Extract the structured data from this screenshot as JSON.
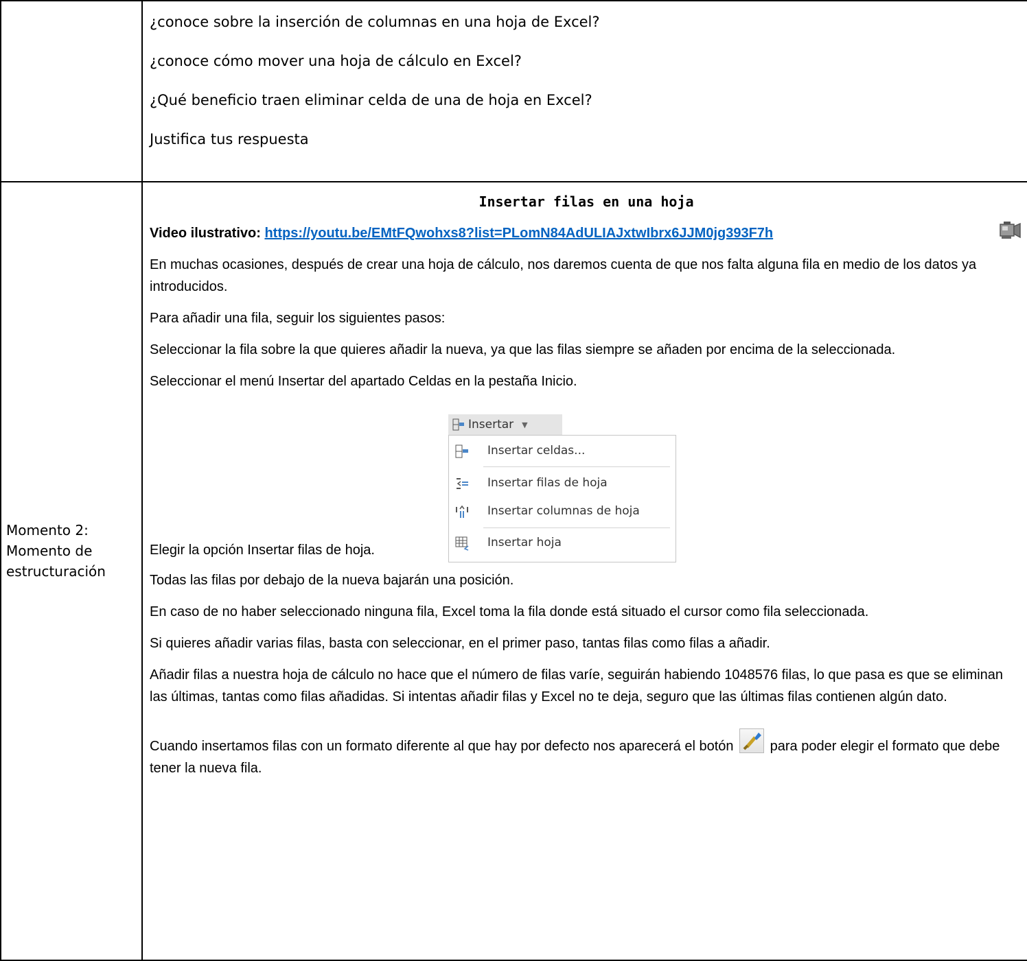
{
  "row1": {
    "questions": [
      "¿conoce sobre la inserción de columnas en una hoja de Excel?",
      "¿conoce cómo mover una hoja de cálculo en Excel?",
      "¿Qué beneficio traen eliminar celda de una de hoja en Excel?",
      "Justifica tus respuesta"
    ]
  },
  "row2": {
    "label_line1": "Momento 2:",
    "label_line2": "Momento de",
    "label_line3": "estructuración",
    "title": "Insertar filas en una hoja",
    "video_label": "Video ilustrativo: ",
    "video_url": "https://youtu.be/EMtFQwohxs8?list=PLomN84AdULIAJxtwIbrx6JJM0jg393F7h",
    "paragraphs": [
      "En muchas ocasiones, después de crear una hoja de cálculo, nos daremos cuenta de que nos falta alguna fila en medio de los datos ya introducidos.",
      "Para añadir una fila, seguir los siguientes pasos:",
      "Seleccionar la fila sobre la que quieres añadir la nueva, ya que las filas siempre se añaden por encima de la seleccionada.",
      "Seleccionar el menú Insertar del apartado Celdas en la pestaña Inicio."
    ],
    "menu": {
      "header": "Insertar",
      "items": [
        "Insertar celdas...",
        "Insertar filas de hoja",
        "Insertar columnas de hoja",
        "Insertar hoja"
      ]
    },
    "elegir": "Elegir la opción Insertar filas de hoja.",
    "after": [
      "Todas las filas por debajo de la nueva bajarán una posición.",
      "En caso de no haber seleccionado ninguna fila, Excel toma la fila donde está situado el cursor como fila seleccionada.",
      "Si quieres añadir varias filas, basta con seleccionar, en el primer paso, tantas filas como filas a añadir.",
      "Añadir filas a nuestra hoja de cálculo no hace que el número de filas varíe, seguirán habiendo 1048576 filas, lo que pasa es que se eliminan las últimas, tantas como filas añadidas. Si intentas añadir filas y Excel no te deja, seguro que las últimas filas contienen algún dato."
    ],
    "last_before": "Cuando insertamos filas con un formato diferente al que hay por defecto nos aparecerá el botón ",
    "last_after": " para poder elegir el formato que debe tener la nueva fila."
  }
}
